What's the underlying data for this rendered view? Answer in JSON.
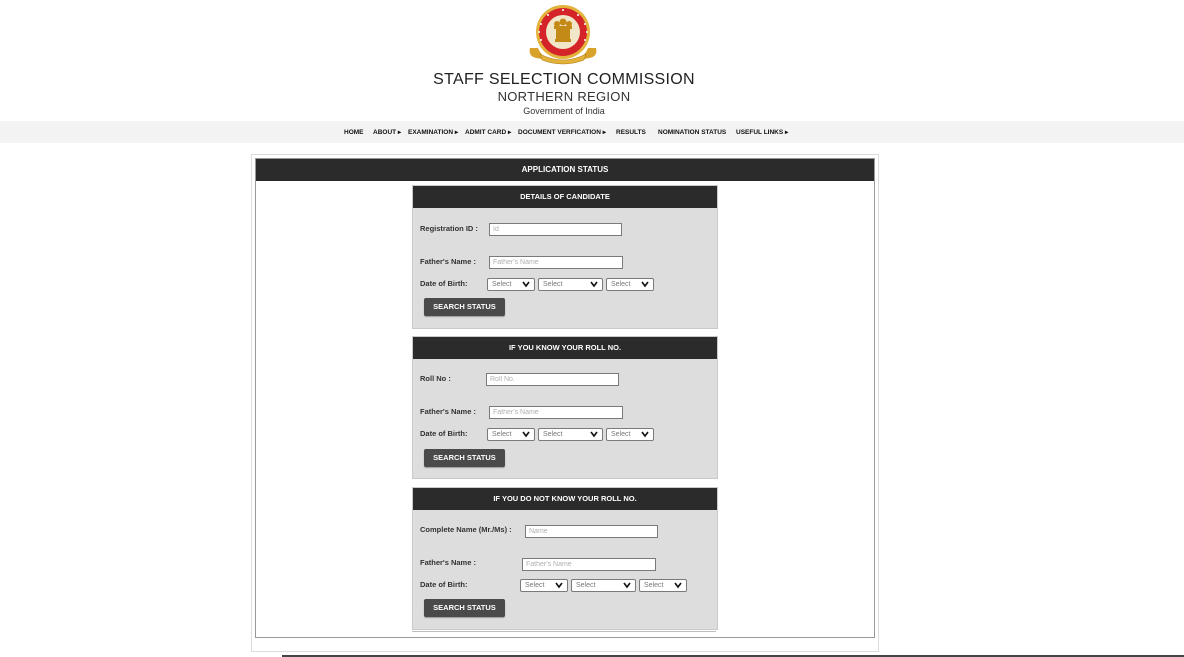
{
  "header": {
    "title": "STAFF SELECTION COMMISSION",
    "region": "NORTHERN REGION",
    "government": "Government of India",
    "emblem_icon": "ssc-emblem-logo"
  },
  "nav": {
    "items": [
      {
        "label": "HOME"
      },
      {
        "label": "ABOUT ▸"
      },
      {
        "label": "EXAMINATION ▸"
      },
      {
        "label": "ADMIT CARD ▸"
      },
      {
        "label": "DOCUMENT VERFICATION ▸"
      },
      {
        "label": "RESULTS"
      },
      {
        "label": "NOMINATION STATUS"
      },
      {
        "label": "USEFUL LINKS ▸"
      }
    ]
  },
  "main": {
    "title": "APPLICATION STATUS"
  },
  "panels": {
    "details": {
      "title": "DETAILS OF CANDIDATE",
      "reg_label": "Registration ID :",
      "reg_placeholder": "Id",
      "father_label": "Father's Name :",
      "father_placeholder": "Father's Name",
      "dob_label": "Date of Birth:",
      "day": "Select",
      "month": "Select",
      "year": "Select",
      "button": "SEARCH STATUS"
    },
    "roll": {
      "title": "IF YOU KNOW YOUR ROLL NO.",
      "roll_label": "Roll No :",
      "roll_placeholder": "Roll No.",
      "father_label": "Father's Name :",
      "father_placeholder": "Father's Name",
      "dob_label": "Date of Birth:",
      "day": "Select",
      "month": "Select",
      "year": "Select",
      "button": "SEARCH STATUS"
    },
    "noroll": {
      "title": "IF YOU DO NOT KNOW YOUR ROLL NO.",
      "name_label": "Complete Name (Mr./Ms) :",
      "name_placeholder": "Name",
      "father_label": "Father's Name :",
      "father_placeholder": "Father's Name",
      "dob_label": "Date of Birth:",
      "day": "Select",
      "month": "Select",
      "year": "Select",
      "button": "SEARCH STATUS"
    }
  },
  "colors": {
    "bar": "#2b2b2b",
    "panel": "#dddddd",
    "button": "#4a4a4a",
    "navbar": "#f3f3f3"
  }
}
